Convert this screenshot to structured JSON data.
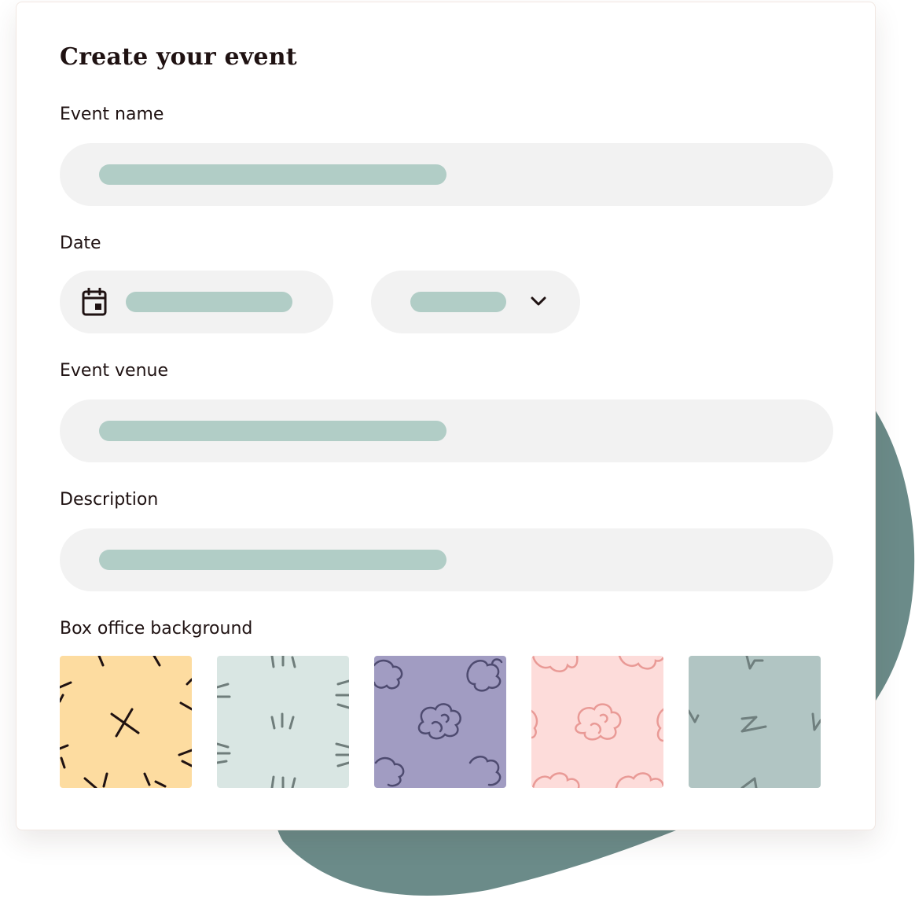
{
  "form": {
    "title": "Create your event",
    "event_name_label": "Event name",
    "date_label": "Date",
    "venue_label": "Event venue",
    "description_label": "Description",
    "background_label": "Box office background"
  },
  "icons": {
    "date": "calendar-icon",
    "time_dropdown": "chevron-down-icon"
  },
  "backgrounds": [
    {
      "name": "yellow-crosses",
      "color": "#fddca0"
    },
    {
      "name": "mint-lines",
      "color": "#d9e6e3"
    },
    {
      "name": "purple-clouds",
      "color": "#a19cc2"
    },
    {
      "name": "pink-clouds",
      "color": "#fddcda"
    },
    {
      "name": "teal-zigzags",
      "color": "#b1c5c3"
    }
  ],
  "colors": {
    "placeholder": "#b1cdc6",
    "field_background": "#f2f2f2",
    "backdrop_blob": "#6b8b89"
  }
}
